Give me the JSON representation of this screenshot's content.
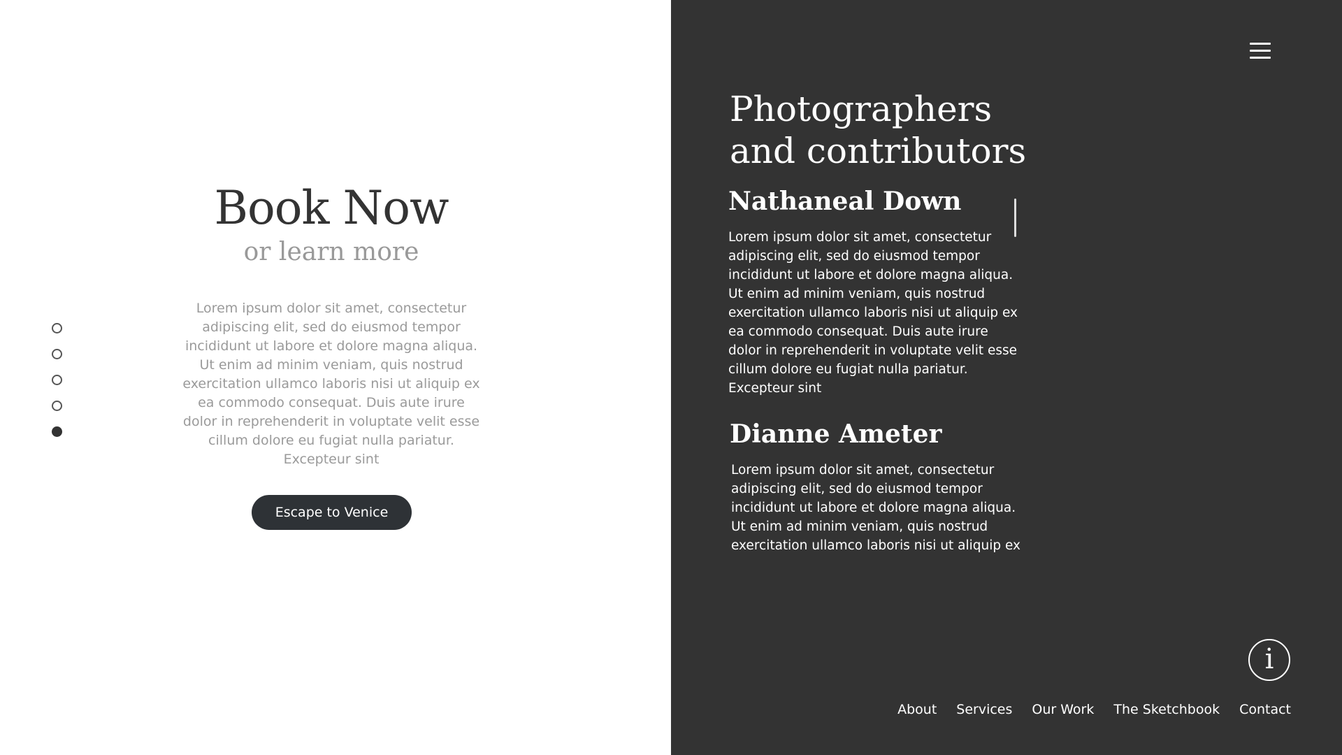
{
  "hero": {
    "title": "Book Now",
    "subtitle": "or learn more",
    "body": "Lorem ipsum dolor sit amet, consectetur adipiscing elit, sed do eiusmod tempor incididunt ut labore et dolore magna aliqua. Ut enim ad minim veniam, quis nostrud exercitation ullamco laboris nisi ut aliquip ex ea commodo consequat. Duis aute irure dolor in reprehenderit in voluptate velit esse cillum dolore eu fugiat nulla pariatur. Excepteur sint",
    "cta_label": "Escape to Venice"
  },
  "slide_nav": {
    "count": 5,
    "active_index": 4
  },
  "panel": {
    "title_line1": "Photographers",
    "title_line2": "and contributors",
    "contributors": [
      {
        "name": "Nathaneal Down",
        "bio": "Lorem ipsum dolor sit amet, consectetur adipiscing elit, sed do eiusmod tempor incididunt ut labore et dolore magna aliqua. Ut enim ad minim veniam, quis nostrud exercitation ullamco laboris nisi ut aliquip ex ea commodo consequat. Duis aute irure dolor in reprehenderit in voluptate velit esse cillum dolore eu fugiat nulla pariatur. Excepteur sint"
      },
      {
        "name": "Dianne Ameter",
        "bio": "Lorem ipsum dolor sit amet, consectetur adipiscing elit, sed do eiusmod tempor incididunt ut labore et dolore magna aliqua. Ut enim ad minim veniam, quis nostrud exercitation ullamco laboris nisi ut aliquip ex ea commodo consequat. Duis aute irure dolor"
      }
    ],
    "info_symbol": "i"
  },
  "footer_nav": {
    "items": [
      "About",
      "Services",
      "Our Work",
      "The Sketchbook",
      "Contact"
    ]
  },
  "icons": {
    "menu": "hamburger-icon",
    "info": "info-icon"
  },
  "colors": {
    "panel_bg": "#333333",
    "button_bg": "#2e3236"
  }
}
